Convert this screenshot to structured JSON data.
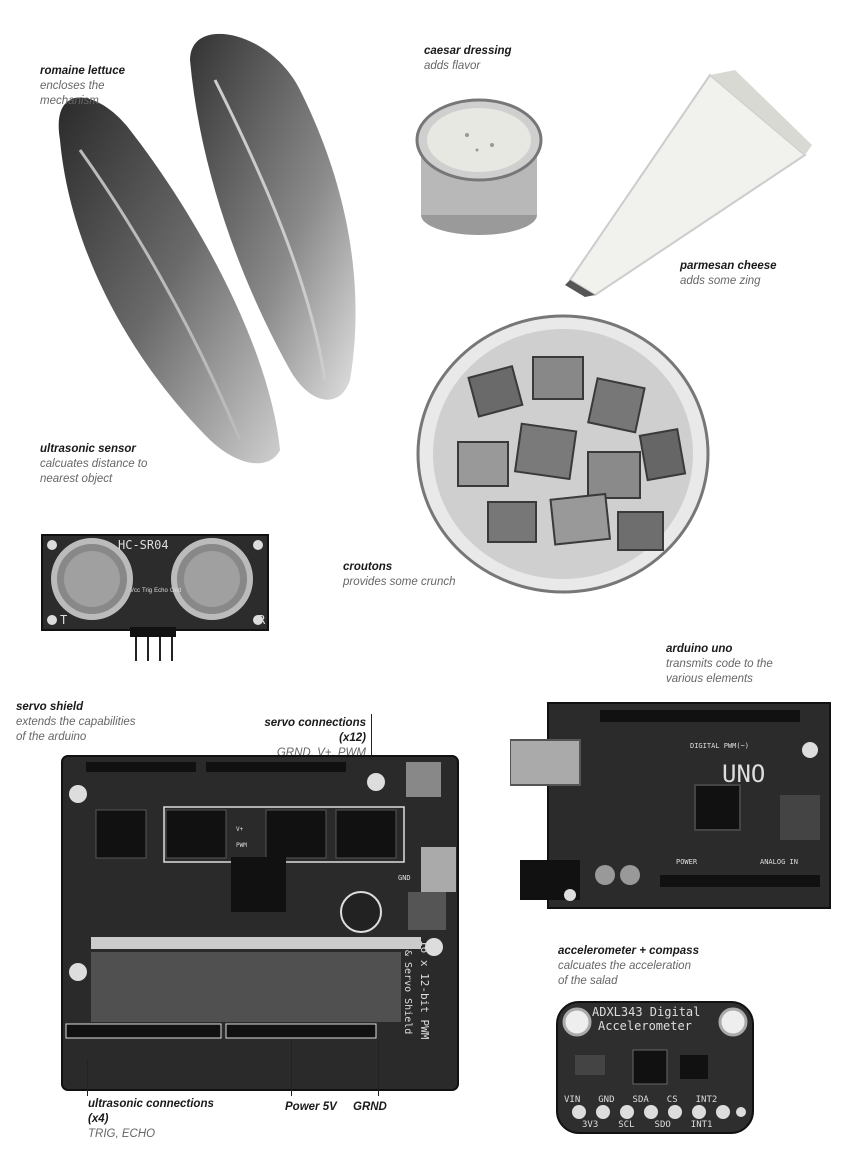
{
  "captions": {
    "romaine": {
      "title": "romaine lettuce",
      "desc": [
        "encloses the",
        "mechanism"
      ]
    },
    "dressing": {
      "title": "caesar dressing",
      "desc": [
        "adds flavor"
      ]
    },
    "parmesan": {
      "title": "parmesan cheese",
      "desc": [
        "adds some zing"
      ]
    },
    "ultrasonic": {
      "title": "ultrasonic sensor",
      "desc": [
        "calcuates distance to",
        "nearest object"
      ]
    },
    "croutons": {
      "title": "croutons",
      "desc": [
        "provides some crunch"
      ]
    },
    "arduino": {
      "title": "arduino uno",
      "desc": [
        "transmits code to the",
        "various elements"
      ]
    },
    "servo_shield": {
      "title": "servo shield",
      "desc": [
        "extends the capabilities",
        "of the arduino"
      ]
    },
    "servo_conn": {
      "title": "servo connections (x12)",
      "desc": [
        "GRND, V+, PWM"
      ]
    },
    "accel": {
      "title": "accelerometer + compass",
      "desc": [
        "calcuates the acceleration",
        "of the salad"
      ]
    },
    "ultra_conn": {
      "title": "ultrasonic connections",
      "title2": "(x4)",
      "desc": [
        "TRIG, ECHO"
      ]
    },
    "power": {
      "title": "Power 5V"
    },
    "grnd": {
      "title": "GRND"
    }
  },
  "board_labels": {
    "hcsr04": "HC-SR04",
    "hc_t": "T",
    "hc_r": "R",
    "hc_pins": [
      "Vcc",
      "Trig",
      "Echo",
      "Gnd"
    ],
    "uno": "UNO",
    "digital_pwm": "DIGITAL PWM(~)",
    "analog_in": "ANALOG IN",
    "power_lbl": "POWER",
    "shield_title": "16 x 12-bit PWM",
    "shield_title2": "& Servo Shield",
    "shield_gnd": "GND",
    "shield_pwm": "PWM",
    "shield_vplus": "V+",
    "accel_title": "ADXL343 Digital",
    "accel_title2": "Accelerometer",
    "accel_pins_top": [
      "VIN",
      "GND",
      "SDA",
      "CS",
      "INT2"
    ],
    "accel_pins_bottom": [
      "3V3",
      "SCL",
      "SDO",
      "INT1"
    ]
  }
}
